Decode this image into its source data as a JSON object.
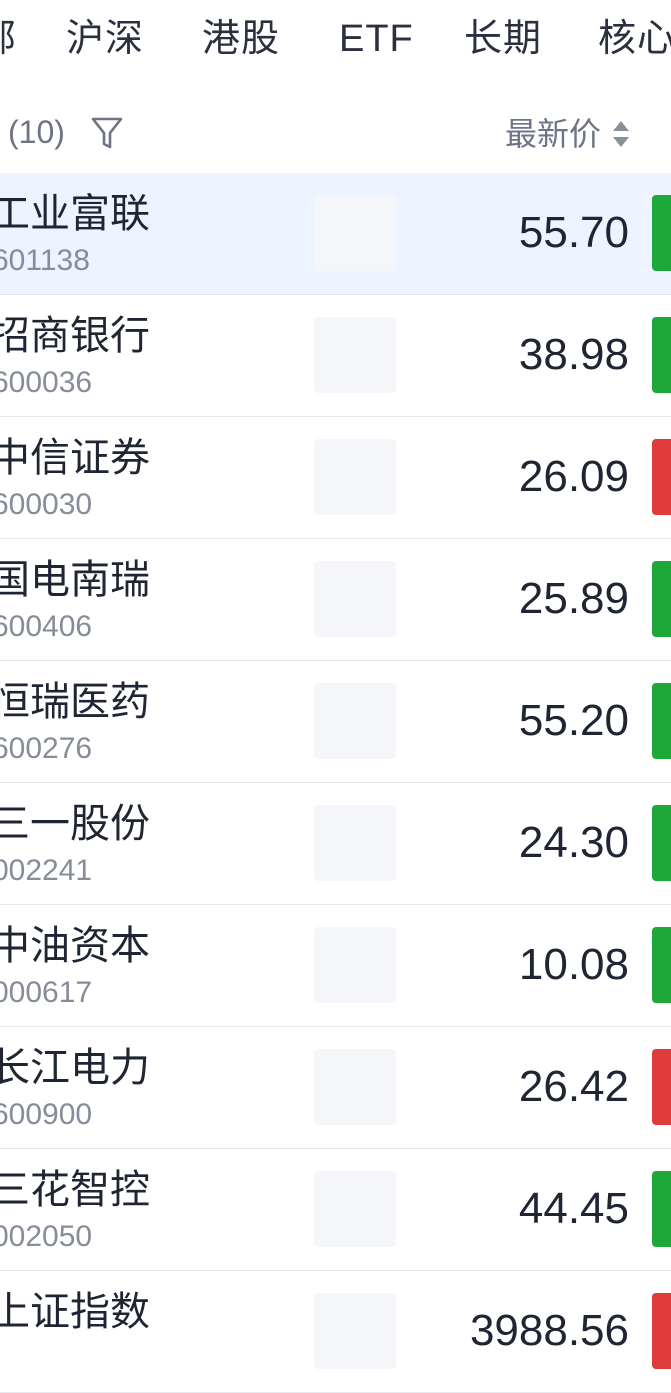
{
  "tabs": [
    {
      "label": "部"
    },
    {
      "label": "沪深"
    },
    {
      "label": "港股"
    },
    {
      "label": "ETF"
    },
    {
      "label": "长期"
    },
    {
      "label": "核心"
    }
  ],
  "list_header": {
    "count": "(10)",
    "sort_label": "最新价"
  },
  "colors": {
    "up": "#e03b3b",
    "down": "#1fa83a",
    "highlight": "#edf4ff"
  },
  "stocks": [
    {
      "name": "工业富联",
      "code": "601138",
      "price": "55.70",
      "direction": "down"
    },
    {
      "name": "招商银行",
      "code": "600036",
      "price": "38.98",
      "direction": "down"
    },
    {
      "name": "中信证券",
      "code": "600030",
      "price": "26.09",
      "direction": "up"
    },
    {
      "name": "国电南瑞",
      "code": "600406",
      "price": "25.89",
      "direction": "down"
    },
    {
      "name": "恒瑞医药",
      "code": "600276",
      "price": "55.20",
      "direction": "down"
    },
    {
      "name": "三一股份",
      "code": "002241",
      "price": "24.30",
      "direction": "down"
    },
    {
      "name": "中油资本",
      "code": "000617",
      "price": "10.08",
      "direction": "down"
    },
    {
      "name": "长江电力",
      "code": "600900",
      "price": "26.42",
      "direction": "up"
    },
    {
      "name": "三花智控",
      "code": "002050",
      "price": "44.45",
      "direction": "down"
    },
    {
      "name": "上证指数",
      "code": "",
      "price": "3988.56",
      "direction": "up"
    }
  ]
}
